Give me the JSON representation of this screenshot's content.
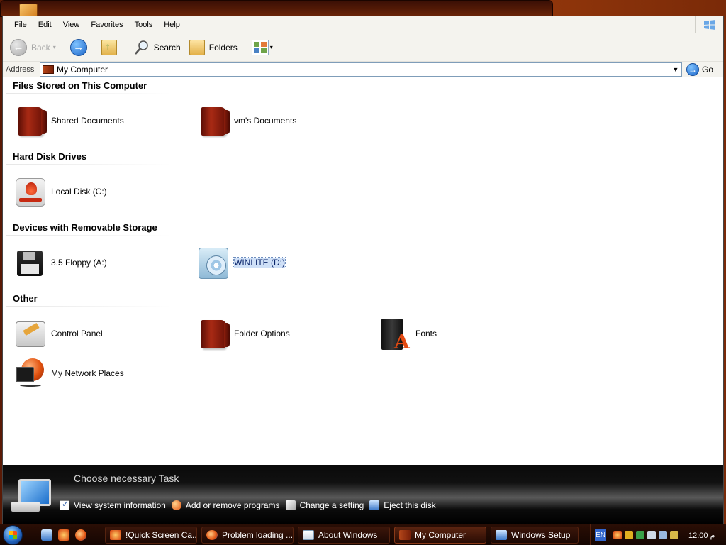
{
  "window": {
    "menu": [
      "File",
      "Edit",
      "View",
      "Favorites",
      "Tools",
      "Help"
    ],
    "toolbar": {
      "back_label": "Back",
      "search_label": "Search",
      "folders_label": "Folders"
    },
    "address": {
      "label": "Address",
      "value": "My Computer",
      "go_label": "Go"
    }
  },
  "groups": [
    {
      "title": "Files Stored on This Computer",
      "items": [
        {
          "label": "Shared Documents",
          "icon": "folder-icon"
        },
        {
          "label": "vm's Documents",
          "icon": "folder-icon"
        }
      ]
    },
    {
      "title": "Hard Disk Drives",
      "items": [
        {
          "label": "Local Disk (C:)",
          "icon": "hard-disk-icon"
        }
      ]
    },
    {
      "title": "Devices with Removable Storage",
      "items": [
        {
          "label": "3.5 Floppy (A:)",
          "icon": "floppy-disk-icon"
        },
        {
          "label": "WINLITE (D:)",
          "icon": "cd-drive-icon",
          "selected": true
        }
      ]
    },
    {
      "title": "Other",
      "items": [
        {
          "label": "Control Panel",
          "icon": "control-panel-icon"
        },
        {
          "label": "Folder Options",
          "icon": "folder-options-icon"
        },
        {
          "label": "Fonts",
          "icon": "fonts-icon"
        },
        {
          "label": "My Network Places",
          "icon": "network-places-icon"
        }
      ]
    }
  ],
  "taskpane": {
    "header": "Choose necessary Task",
    "links": [
      {
        "label": "View system information",
        "icon": "checkbox-icon"
      },
      {
        "label": "Add or remove programs",
        "icon": "add-remove-icon"
      },
      {
        "label": "Change a setting",
        "icon": "settings-icon"
      },
      {
        "label": "Eject this disk",
        "icon": "eject-icon"
      }
    ]
  },
  "taskbar": {
    "buttons": [
      {
        "label": "!Quick Screen Ca...",
        "icon": "capture-icon"
      },
      {
        "label": "Problem loading ...",
        "icon": "firefox-icon"
      },
      {
        "label": "About Windows",
        "icon": "window-icon"
      },
      {
        "label": "My Computer",
        "icon": "my-computer-icon",
        "active": true
      },
      {
        "label": "Windows Setup",
        "icon": "setup-icon"
      }
    ],
    "tray": {
      "language": "EN",
      "clock": "12:00 م"
    }
  }
}
